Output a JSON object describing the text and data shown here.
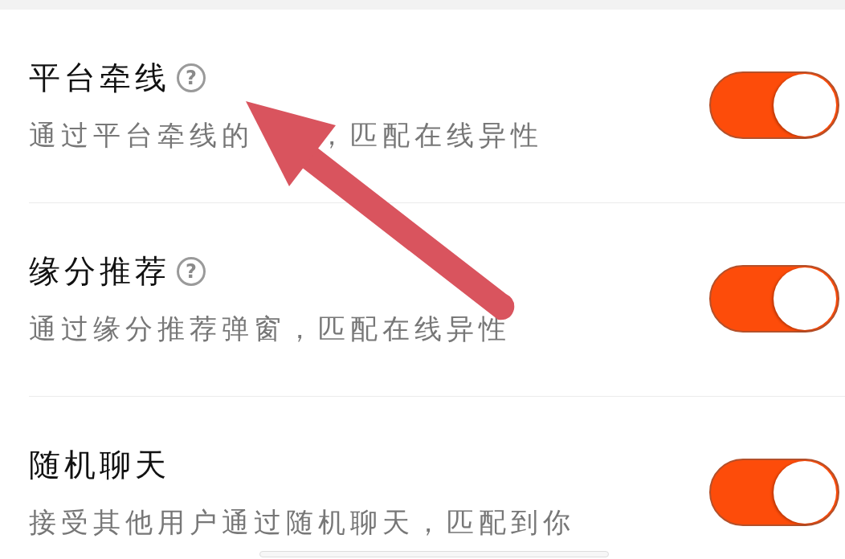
{
  "settings": [
    {
      "title": "平台牵线",
      "help": "?",
      "description": [
        "通过平台牵线的",
        "，匹配在线异性"
      ],
      "on": true
    },
    {
      "title": "缘分推荐",
      "help": "?",
      "description": [
        "通过缘分推荐弹窗，匹配在线异性"
      ],
      "on": true
    },
    {
      "title": "随机聊天",
      "description": [
        "接受其他用户通过随机聊天，匹配到你"
      ],
      "on": true
    }
  ]
}
